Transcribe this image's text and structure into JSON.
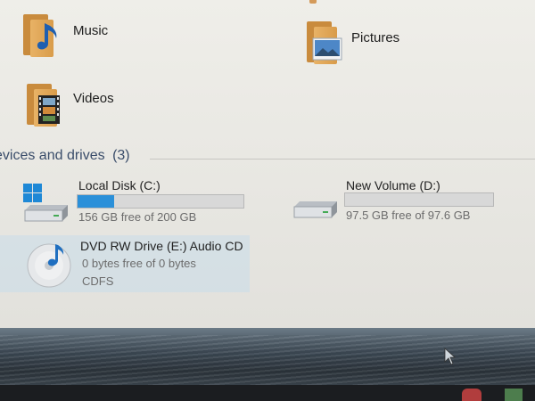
{
  "libraries": [
    {
      "label": "Music"
    },
    {
      "label": "Pictures"
    },
    {
      "label": "Videos"
    }
  ],
  "section": {
    "title": "evices and drives",
    "count": "(3)"
  },
  "drives": [
    {
      "name": "Local Disk (C:)",
      "free_text": "156 GB free of 200 GB",
      "used_fraction": 0.22
    },
    {
      "name": "New Volume (D:)",
      "free_text": "97.5 GB free of 97.6 GB",
      "used_fraction": 0.0
    },
    {
      "name": "DVD RW Drive (E:) Audio CD",
      "free_text": "0 bytes free of 0 bytes",
      "filesystem": "CDFS"
    }
  ],
  "colors": {
    "progress_fill": "#2b90d9",
    "folder": "#e1a755",
    "section_header": "#3a4d6a",
    "selection": "#c9dcea"
  },
  "icons": [
    "music-note-icon",
    "picture-icon",
    "film-strip-icon",
    "windows-logo-icon",
    "hard-drive-icon",
    "cd-disc-icon",
    "mouse-cursor-icon"
  ]
}
